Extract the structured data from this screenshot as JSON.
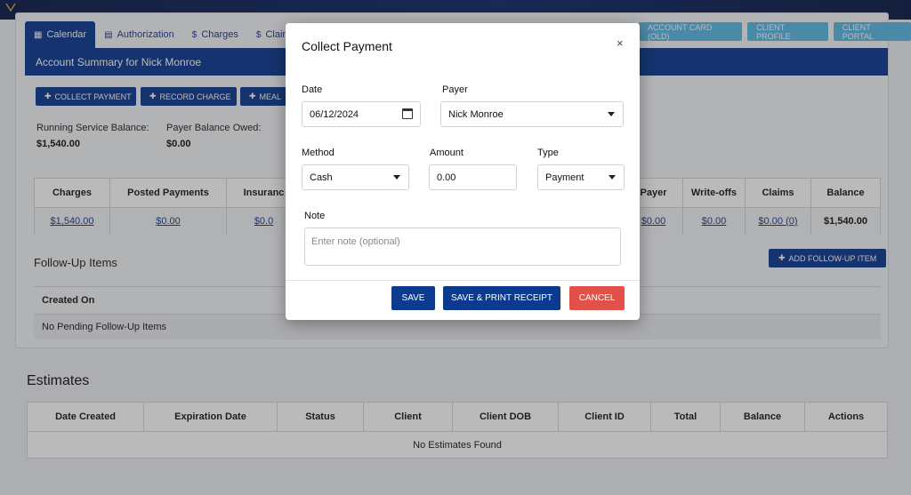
{
  "tabs": [
    {
      "label": "Calendar",
      "icon": "calendar-icon"
    },
    {
      "label": "Authorization",
      "icon": "document-icon"
    },
    {
      "label": "Charges",
      "icon": "dollar-icon"
    },
    {
      "label": "Claim",
      "icon": "dollar-icon"
    }
  ],
  "right_buttons": [
    "ACCOUNT CARD (OLD)",
    "CLIENT PROFILE",
    "CLIENT PORTAL"
  ],
  "summary_title": "Account Summary for Nick Monroe",
  "actions": {
    "collect": "COLLECT PAYMENT",
    "record": "RECORD CHARGE",
    "meal": "MEAL"
  },
  "balances": {
    "running_label": "Running Service Balance:",
    "running_value": "$1,540.00",
    "payer_label": "Payer Balance Owed:",
    "payer_value": "$0.00"
  },
  "ledger": {
    "headers": [
      "Charges",
      "Posted Payments",
      "Insuranc",
      "Payer",
      "Write-offs",
      "Claims",
      "Balance"
    ],
    "values": [
      "$1,540.00",
      "$0.00",
      "$0.0",
      "$0.00",
      "$0.00",
      "$0.00 (0)",
      "$1,540.00"
    ]
  },
  "followup": {
    "title": "Follow-Up Items",
    "add_button": "ADD FOLLOW-UP ITEM",
    "column": "Created On",
    "empty": "No Pending Follow-Up Items"
  },
  "estimates": {
    "title": "Estimates",
    "columns": [
      "Date Created",
      "Expiration Date",
      "Status",
      "Client",
      "Client DOB",
      "Client ID",
      "Total",
      "Balance",
      "Actions"
    ],
    "empty": "No Estimates Found"
  },
  "modal": {
    "title": "Collect Payment",
    "close": "×",
    "date_label": "Date",
    "date_value": "06/12/2024",
    "payer_label": "Payer",
    "payer_value": "Nick Monroe",
    "method_label": "Method",
    "method_value": "Cash",
    "amount_label": "Amount",
    "amount_value": "0.00",
    "type_label": "Type",
    "type_value": "Payment",
    "note_label": "Note",
    "note_placeholder": "Enter note (optional)",
    "save": "SAVE",
    "save_print": "SAVE & PRINT RECEIPT",
    "cancel": "CANCEL"
  },
  "colors": {
    "primary": "#0c3a8f",
    "light_blue": "#5cb7e3",
    "cancel": "#e0514a"
  }
}
